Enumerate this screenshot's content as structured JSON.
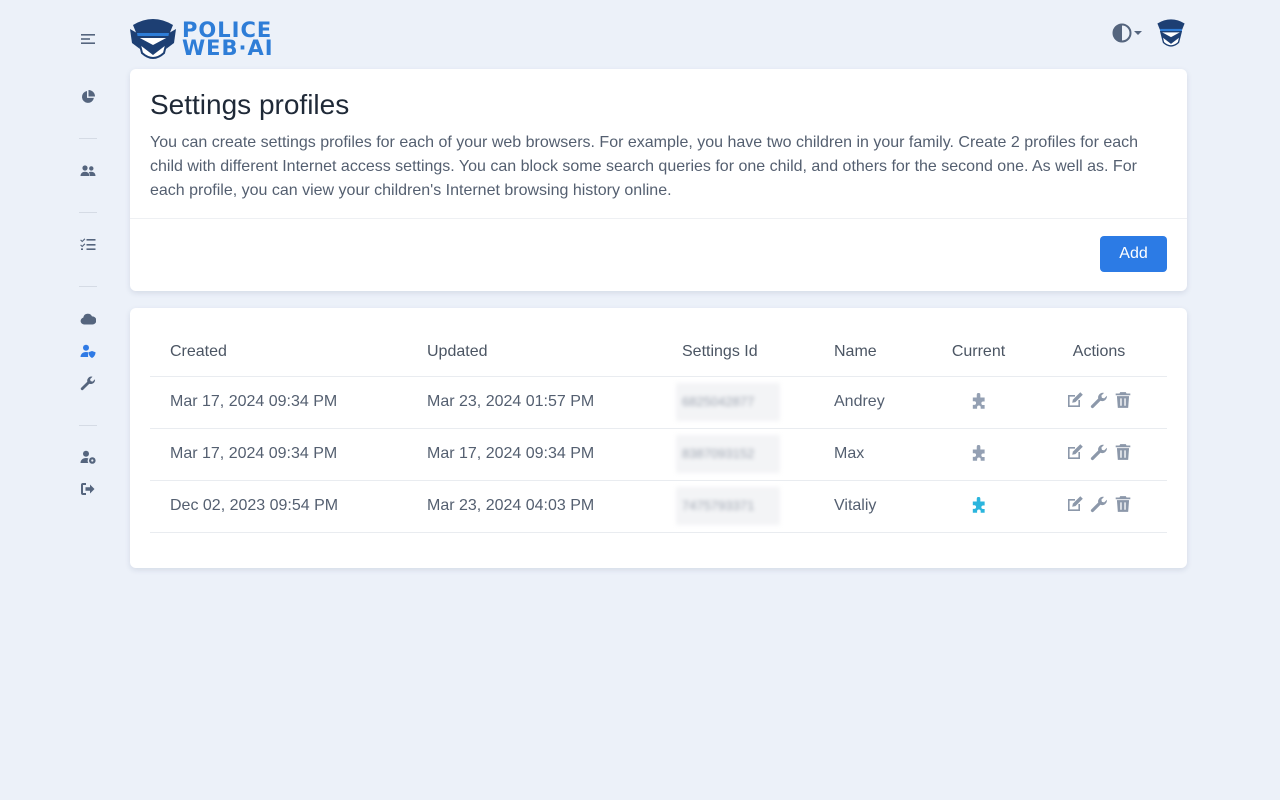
{
  "brand": {
    "line1": "POLICE",
    "line2": "WEB·AI"
  },
  "sidebar": {
    "items": [
      {
        "icon": "menu-icon"
      },
      {
        "icon": "pie-chart-icon"
      },
      {
        "icon": "users-icon"
      },
      {
        "icon": "tasks-icon"
      },
      {
        "icon": "cloud-icon"
      },
      {
        "icon": "user-shield-icon",
        "active": true
      },
      {
        "icon": "wrench-icon"
      },
      {
        "icon": "user-gear-icon"
      },
      {
        "icon": "sign-out-icon"
      }
    ]
  },
  "intro": {
    "title": "Settings profiles",
    "description": "You can create settings profiles for each of your web browsers. For example, you have two children in your family. Create 2 profiles for each child with different Internet access settings. You can block some search queries for one child, and others for the second one. As well as. For each profile, you can view your children's Internet browsing history online.",
    "add_label": "Add"
  },
  "table": {
    "headers": {
      "created": "Created",
      "updated": "Updated",
      "settings_id": "Settings Id",
      "name": "Name",
      "current": "Current",
      "actions": "Actions"
    },
    "rows": [
      {
        "created": "Mar 17, 2024 09:34 PM",
        "updated": "Mar 23, 2024 01:57 PM",
        "settings_id": "6825042877",
        "name": "Andrey",
        "current": false
      },
      {
        "created": "Mar 17, 2024 09:34 PM",
        "updated": "Mar 17, 2024 09:34 PM",
        "settings_id": "8387093152",
        "name": "Max",
        "current": false
      },
      {
        "created": "Dec 02, 2023 09:54 PM",
        "updated": "Mar 23, 2024 04:03 PM",
        "settings_id": "7475793371",
        "name": "Vitaliy",
        "current": true
      }
    ]
  },
  "colors": {
    "accent": "#2c7be5",
    "current_icon": "#2bb5dd",
    "background": "#ecf1f9"
  }
}
